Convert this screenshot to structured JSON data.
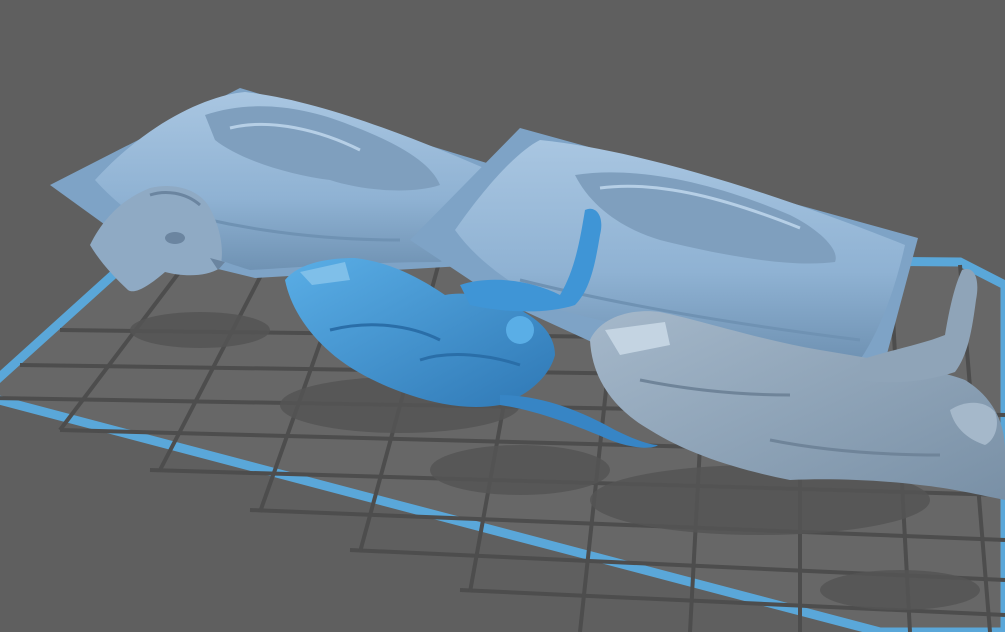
{
  "app": {
    "view": "slicer-3d-viewport"
  },
  "colors": {
    "background": "#5f5f5f",
    "plate_fill": "#666666",
    "plate_border": "#5aa7d9",
    "grid_line": "#4a4a4a",
    "model_default": "#92b6d6",
    "model_default_shadow": "#6e93b5",
    "model_selected": "#3f95d6",
    "model_selected_shadow": "#2f73ad",
    "model_dim": "#8fa4b8",
    "shadow": "#4f4f4f"
  },
  "scene": {
    "objects": [
      {
        "name": "pillow-left",
        "selected": false
      },
      {
        "name": "pillow-right",
        "selected": false
      },
      {
        "name": "dog-figure-left",
        "selected": false
      },
      {
        "name": "lizard-figure-center",
        "selected": true
      },
      {
        "name": "hooded-figure-right",
        "selected": false
      }
    ]
  }
}
